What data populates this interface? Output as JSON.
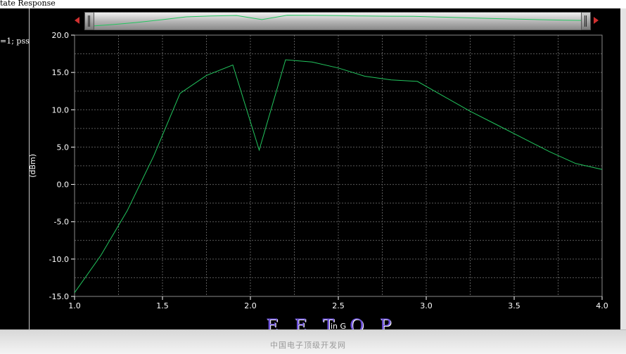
{
  "window": {
    "title": "tate Response"
  },
  "left_panel": {
    "label": "=1; pss"
  },
  "watermark": {
    "main": "E E T O P",
    "sub": "中国电子顶级开发网"
  },
  "colors": {
    "trace": "#22c55e",
    "grid": "#5a5a5a",
    "axis": "#ffffff"
  },
  "chart_data": {
    "type": "line",
    "title": "",
    "xlabel": "in G",
    "ylabel": "(dBm)",
    "xlim": [
      1.0,
      4.0
    ],
    "ylim": [
      -15.0,
      20.0
    ],
    "x_ticks": [
      "1.0",
      "1.5",
      "2.0",
      "2.5",
      "3.0",
      "3.5",
      "4.0"
    ],
    "y_ticks": [
      "20.0",
      "15.0",
      "10.0",
      "5.0",
      "0.0",
      "-5.0",
      "-10.0",
      "-15.0"
    ],
    "grid": true,
    "series": [
      {
        "x": [
          1.0,
          1.15,
          1.3,
          1.45,
          1.6,
          1.75,
          1.9,
          2.05,
          2.2,
          2.35,
          2.5,
          2.65,
          2.8,
          2.95,
          3.1,
          3.25,
          3.4,
          3.55,
          3.7,
          3.85,
          4.0
        ],
        "y": [
          -14.5,
          -9.5,
          -3.5,
          3.8,
          12.2,
          14.6,
          16.0,
          4.6,
          16.7,
          16.4,
          15.6,
          14.5,
          14.0,
          13.8,
          11.8,
          9.8,
          8.0,
          6.2,
          4.4,
          2.8,
          2.0
        ]
      }
    ]
  }
}
